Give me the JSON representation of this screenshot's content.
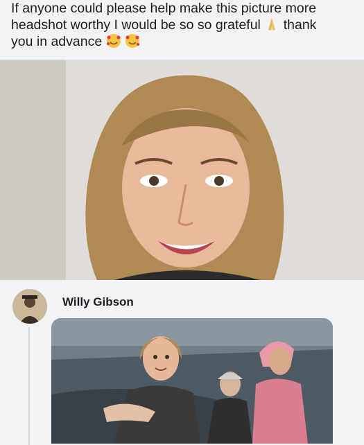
{
  "post": {
    "text_line1": "If anyone could please help make this picture more",
    "text_line2_a": "headshot worthy I would be so so grateful",
    "text_line2_b": "thank",
    "text_line3": "you in advance",
    "emoji_pray": "folded-hands-emoji",
    "emoji_love": "smiling-face-with-hearts-emoji"
  },
  "comment": {
    "author": "Willy Gibson",
    "image": "edited-photo-car-scene"
  },
  "colors": {
    "background": "#f2f3f5",
    "text": "#1c1e21"
  }
}
